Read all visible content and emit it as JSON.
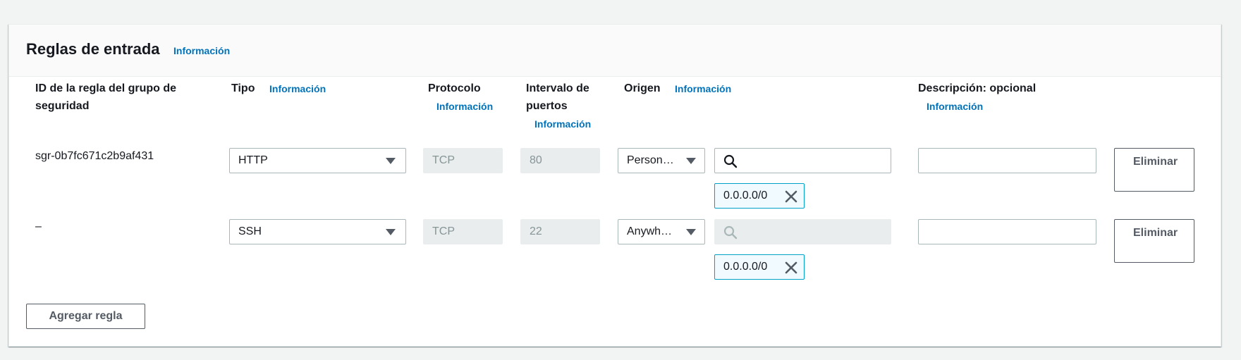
{
  "panel": {
    "title": "Reglas de entrada",
    "info": "Información"
  },
  "columns": {
    "rule_id": "ID de la regla del grupo de seguridad",
    "type": "Tipo",
    "type_info": "Información",
    "protocol": "Protocolo",
    "protocol_info": "Información",
    "port_range": "Intervalo de puertos",
    "port_range_info": "Información",
    "source": "Origen",
    "source_info": "Información",
    "description": "Descripción: opcional",
    "description_info": "Información"
  },
  "rules": [
    {
      "id": "sgr-0b7fc671c2b9af431",
      "type": "HTTP",
      "protocol": "TCP",
      "port_range": "80",
      "source": "Person…",
      "cidr_search_value": "",
      "cidr_search_disabled": false,
      "cidr_token": "0.0.0.0/0",
      "description": "",
      "delete_label": "Eliminar"
    },
    {
      "id": "–",
      "type": "SSH",
      "protocol": "TCP",
      "port_range": "22",
      "source": "Anywh…",
      "cidr_search_value": "",
      "cidr_search_disabled": true,
      "cidr_token": "0.0.0.0/0",
      "description": "",
      "delete_label": "Eliminar"
    }
  ],
  "add_rule_label": "Agregar regla",
  "icons": {
    "search": "search-icon",
    "remove_token": "close-icon",
    "dropdown": "caret-down-icon"
  },
  "colors": {
    "link": "#0073bb",
    "token_border": "#00a1c9",
    "token_bg": "#f1faff",
    "disabled_bg": "#eaeded"
  }
}
